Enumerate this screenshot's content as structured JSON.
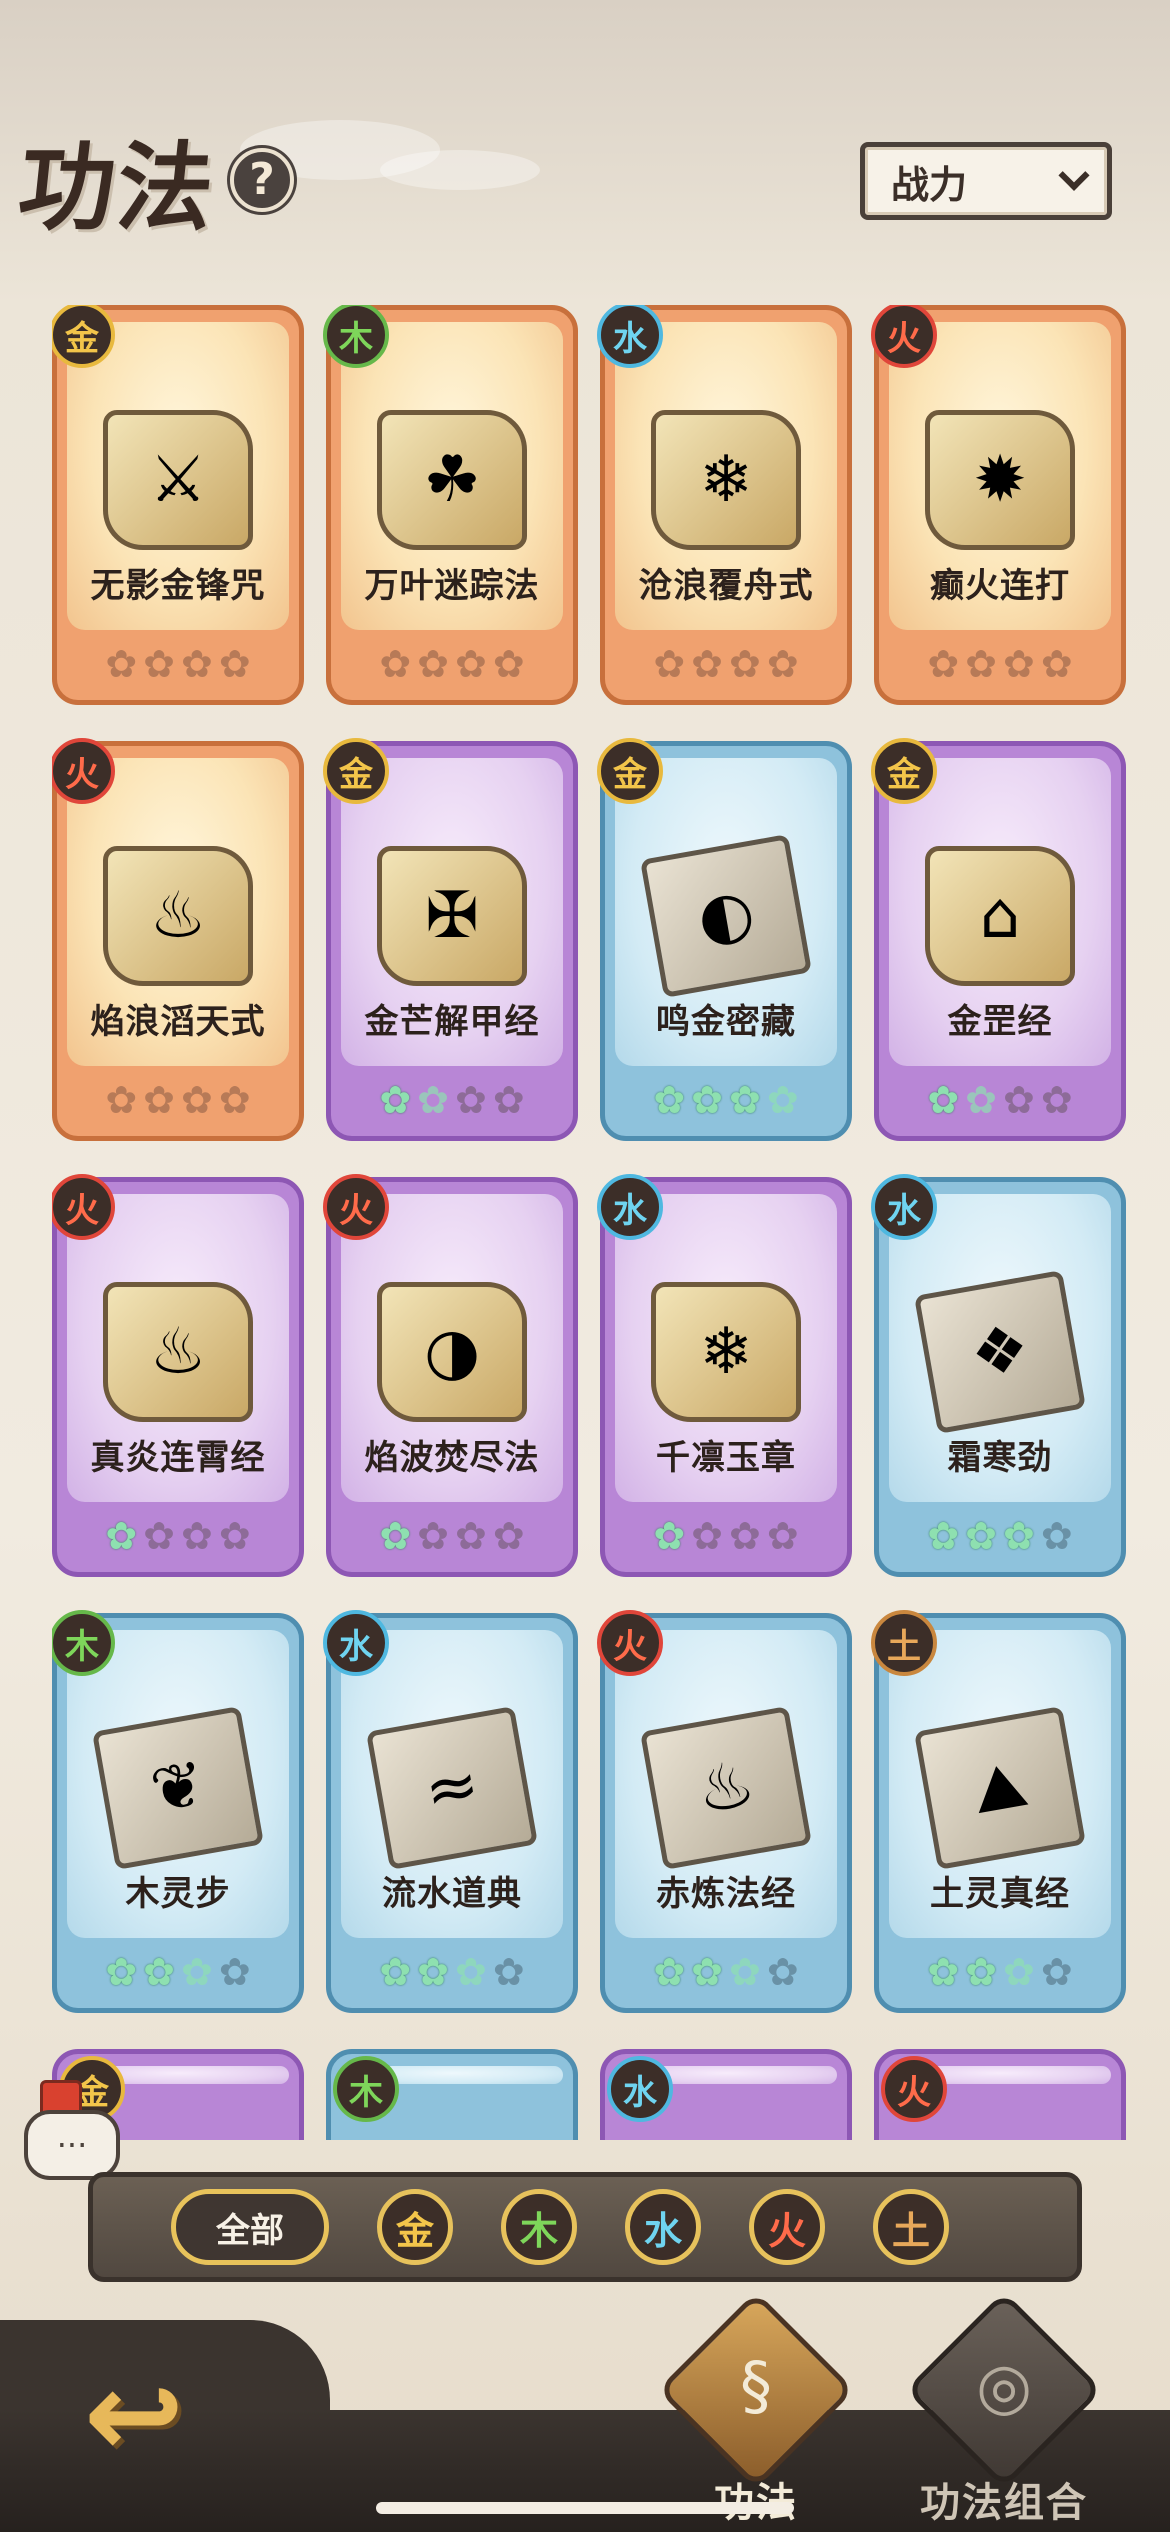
{
  "header": {
    "title": "功法",
    "help_glyph": "?",
    "sort_label": "战力"
  },
  "cards": [
    {
      "name": "无影金锋咒",
      "element": "金",
      "el": "jin",
      "theme": "orange",
      "art": "scroll",
      "glyph": "⚔",
      "stars": [
        "off",
        "off",
        "off",
        "off"
      ]
    },
    {
      "name": "万叶迷踪法",
      "element": "木",
      "el": "mu",
      "theme": "orange",
      "art": "scroll",
      "glyph": "☘",
      "stars": [
        "off",
        "off",
        "off",
        "off"
      ]
    },
    {
      "name": "沧浪覆舟式",
      "element": "水",
      "el": "shui",
      "theme": "orange",
      "art": "scroll",
      "glyph": "❄",
      "stars": [
        "off",
        "off",
        "off",
        "off"
      ]
    },
    {
      "name": "癫火连打",
      "element": "火",
      "el": "huo",
      "theme": "orange",
      "art": "scroll",
      "glyph": "✹",
      "stars": [
        "off",
        "off",
        "off",
        "off"
      ]
    },
    {
      "name": "焰浪滔天式",
      "element": "火",
      "el": "huo",
      "theme": "orange",
      "art": "scroll",
      "glyph": "♨",
      "stars": [
        "off",
        "off",
        "off",
        "off"
      ]
    },
    {
      "name": "金芒解甲经",
      "element": "金",
      "el": "jin",
      "theme": "purple",
      "art": "scroll",
      "glyph": "✠",
      "stars": [
        "on",
        "half",
        "off",
        "off"
      ]
    },
    {
      "name": "鸣金密藏",
      "element": "金",
      "el": "jin",
      "theme": "blue",
      "art": "book",
      "glyph": "◐",
      "stars": [
        "on",
        "on",
        "on",
        "half"
      ]
    },
    {
      "name": "金罡经",
      "element": "金",
      "el": "jin",
      "theme": "purple",
      "art": "scroll",
      "glyph": "⌂",
      "stars": [
        "on",
        "half",
        "off",
        "off"
      ]
    },
    {
      "name": "真炎连霄经",
      "element": "火",
      "el": "huo",
      "theme": "purple",
      "art": "scroll",
      "glyph": "♨",
      "stars": [
        "on",
        "off",
        "off",
        "off"
      ]
    },
    {
      "name": "焰波焚尽法",
      "element": "火",
      "el": "huo",
      "theme": "purple",
      "art": "scroll",
      "glyph": "◑",
      "stars": [
        "on",
        "off",
        "off",
        "off"
      ]
    },
    {
      "name": "千凛玉章",
      "element": "水",
      "el": "shui",
      "theme": "purple",
      "art": "scroll",
      "glyph": "❄",
      "stars": [
        "on",
        "off",
        "off",
        "off"
      ]
    },
    {
      "name": "霜寒劲",
      "element": "水",
      "el": "shui",
      "theme": "blue",
      "art": "book",
      "glyph": "❖",
      "stars": [
        "on",
        "on",
        "on",
        "off"
      ]
    },
    {
      "name": "木灵步",
      "element": "木",
      "el": "mu",
      "theme": "blue",
      "art": "book",
      "glyph": "❦",
      "stars": [
        "on",
        "on",
        "half",
        "off"
      ]
    },
    {
      "name": "流水道典",
      "element": "水",
      "el": "shui",
      "theme": "blue",
      "art": "book",
      "glyph": "≈",
      "stars": [
        "on",
        "on",
        "half",
        "off"
      ]
    },
    {
      "name": "赤炼法经",
      "element": "火",
      "el": "huo",
      "theme": "blue",
      "art": "book",
      "glyph": "♨",
      "stars": [
        "on",
        "on",
        "half",
        "off"
      ]
    },
    {
      "name": "土灵真经",
      "element": "土",
      "el": "tu",
      "theme": "blue",
      "art": "book",
      "glyph": "⛰",
      "stars": [
        "on",
        "on",
        "half",
        "off"
      ]
    }
  ],
  "partial_cards": [
    {
      "element": "金",
      "el": "jin",
      "theme": "purple"
    },
    {
      "element": "木",
      "el": "mu",
      "theme": "blue"
    },
    {
      "element": "水",
      "el": "shui",
      "theme": "purple"
    },
    {
      "element": "火",
      "el": "huo",
      "theme": "purple"
    }
  ],
  "chat": {
    "glyph": "···"
  },
  "filter": {
    "all_label": "全部",
    "elements": [
      {
        "label": "金",
        "el": "jin",
        "color": "#f3c54a"
      },
      {
        "label": "木",
        "el": "mu",
        "color": "#7ed65a"
      },
      {
        "label": "水",
        "el": "shui",
        "color": "#6fd4f0"
      },
      {
        "label": "火",
        "el": "huo",
        "color": "#ff6b4a"
      },
      {
        "label": "土",
        "el": "tu",
        "color": "#e8a85a"
      }
    ]
  },
  "bottom_nav": {
    "back_glyph": "↩",
    "tab_active_label": "功法",
    "tab_active_glyph": "§",
    "tab_combo_label": "功法组合",
    "tab_combo_glyph": "◎"
  }
}
